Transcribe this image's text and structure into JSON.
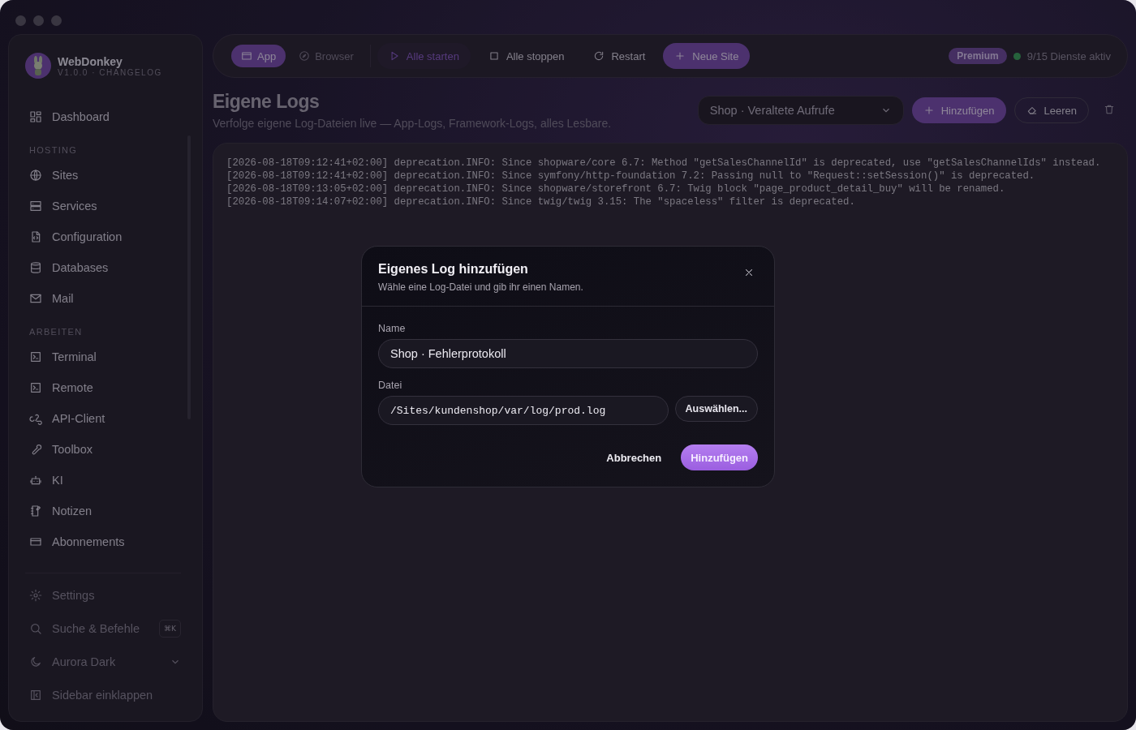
{
  "app": {
    "name": "WebDonkey",
    "version": "V1.0.0 · CHANGELOG"
  },
  "sidebar": {
    "top": [
      {
        "label": "Dashboard"
      }
    ],
    "sections": [
      {
        "title": "HOSTING",
        "items": [
          {
            "label": "Sites"
          },
          {
            "label": "Services"
          },
          {
            "label": "Configuration"
          },
          {
            "label": "Databases"
          },
          {
            "label": "Mail"
          }
        ]
      },
      {
        "title": "ARBEITEN",
        "items": [
          {
            "label": "Terminal"
          },
          {
            "label": "Remote"
          },
          {
            "label": "API-Client"
          },
          {
            "label": "Toolbox"
          },
          {
            "label": "KI"
          },
          {
            "label": "Notizen"
          },
          {
            "label": "Abonnements"
          }
        ]
      }
    ],
    "footer": [
      {
        "kind": "plain",
        "label": "Settings"
      },
      {
        "kind": "shortcut",
        "label": "Suche & Befehle",
        "shortcut": "⌘K"
      },
      {
        "kind": "dropdown",
        "label": "Aurora Dark"
      },
      {
        "kind": "plain",
        "label": "Sidebar einklappen"
      }
    ]
  },
  "toolbar": {
    "modes": [
      {
        "label": "App",
        "selected": true
      },
      {
        "label": "Browser",
        "selected": false
      }
    ],
    "actions": [
      {
        "label": "Alle starten",
        "kind": "accent"
      },
      {
        "label": "Alle stoppen",
        "kind": "plain"
      },
      {
        "label": "Restart",
        "kind": "plain"
      },
      {
        "label": "Neue Site",
        "kind": "primary"
      }
    ],
    "badge": "Premium",
    "status": "9/15 Dienste aktiv"
  },
  "page": {
    "title": "Eigene Logs",
    "subtitle": "Verfolge eigene Log-Dateien live — App-Logs, Framework-Logs, alles Lesbare.",
    "log_select": "Shop · Veraltete Aufrufe",
    "add_button": "Hinzufügen",
    "clear_button": "Leeren"
  },
  "log_lines": [
    "[2026-08-18T09:12:41+02:00] deprecation.INFO: Since shopware/core 6.7: Method \"getSalesChannelId\" is deprecated, use \"getSalesChannelIds\" instead.",
    "[2026-08-18T09:12:41+02:00] deprecation.INFO: Since symfony/http-foundation 7.2: Passing null to \"Request::setSession()\" is deprecated.",
    "[2026-08-18T09:13:05+02:00] deprecation.INFO: Since shopware/storefront 6.7: Twig block \"page_product_detail_buy\" will be renamed.",
    "[2026-08-18T09:14:07+02:00] deprecation.INFO: Since twig/twig 3.15: The \"spaceless\" filter is deprecated."
  ],
  "dialog": {
    "title": "Eigenes Log hinzufügen",
    "subtitle": "Wähle eine Log-Datei und gib ihr einen Namen.",
    "name_label": "Name",
    "name_value": "Shop · Fehlerprotokoll",
    "file_label": "Datei",
    "file_value": "/Sites/kundenshop/var/log/prod.log",
    "browse_button": "Auswählen...",
    "cancel_button": "Abbrechen",
    "confirm_button": "Hinzufügen"
  }
}
